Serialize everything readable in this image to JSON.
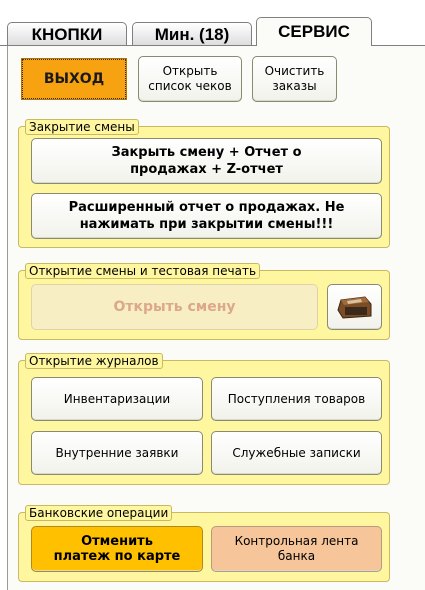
{
  "tabs": [
    {
      "label": "КНОПКИ"
    },
    {
      "label": "Мин. (18)"
    },
    {
      "label": "СЕРВИС"
    }
  ],
  "toolbar": {
    "exit_label": "ВЫХОД",
    "open_receipts_label": "Открыть список чеков",
    "clear_orders_label": "Очистить заказы"
  },
  "shift_close": {
    "legend": "Закрытие смены",
    "close_shift_label": "Закрыть смену + Отчет о продажах + Z-отчет",
    "extended_report_label": "Расширенный отчет о продажах. Не нажимать при закрытии смены!!!"
  },
  "shift_open": {
    "legend": "Открытие смены и тестовая печать",
    "open_shift_label": "Открыть смену",
    "printer_icon": "receipt-printer-icon"
  },
  "journals": {
    "legend": "Открытие журналов",
    "inventory_label": "Инвентаризации",
    "receipts_label": "Поступления товаров",
    "internal_requests_label": "Внутренние заявки",
    "memos_label": "Служебные записки"
  },
  "bank": {
    "legend": "Банковские операции",
    "cancel_payment_label": "Отменить платеж по карте",
    "control_tape_label": "Контрольная лента банка"
  },
  "colors": {
    "group_bg": "#fff6a0",
    "exit_button": "#f7a210",
    "cancel_payment_button": "#ffc000",
    "control_tape_button": "#f6c59a"
  }
}
